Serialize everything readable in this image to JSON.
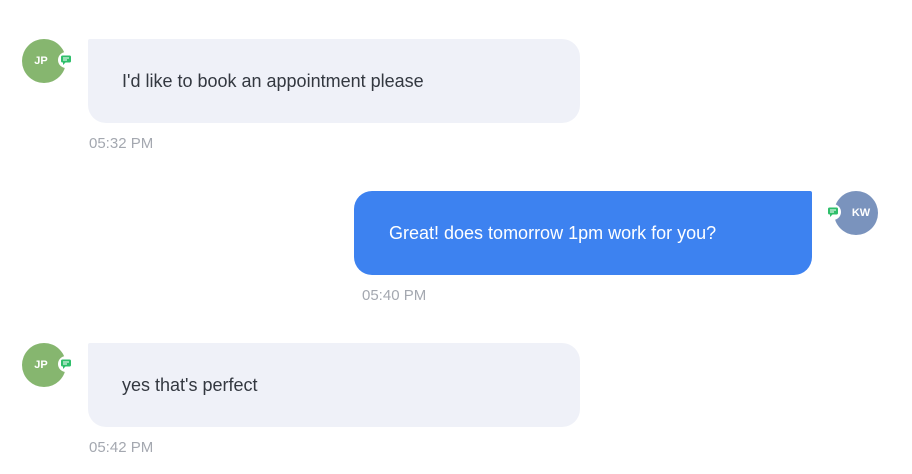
{
  "conversation": {
    "messages": [
      {
        "direction": "inbound",
        "sender_initials": "JP",
        "channel_icon": "sms-chat-icon",
        "text": "I'd like to book an appointment please",
        "time": "05:32 PM"
      },
      {
        "direction": "outbound",
        "sender_initials": "KW",
        "channel_icon": "sms-chat-icon",
        "text": "Great! does tomorrow 1pm work for you?",
        "time": "05:40 PM"
      },
      {
        "direction": "inbound",
        "sender_initials": "JP",
        "channel_icon": "sms-chat-icon",
        "text": "yes that's perfect",
        "time": "05:42 PM"
      }
    ]
  },
  "colors": {
    "inbound_bubble": "#eff1f8",
    "outbound_bubble": "#3d82f0",
    "inbound_avatar": "#86b66f",
    "outbound_avatar": "#7a93bd",
    "channel_badge": "#2fbf6b",
    "timestamp_text": "#a4a8b0"
  }
}
